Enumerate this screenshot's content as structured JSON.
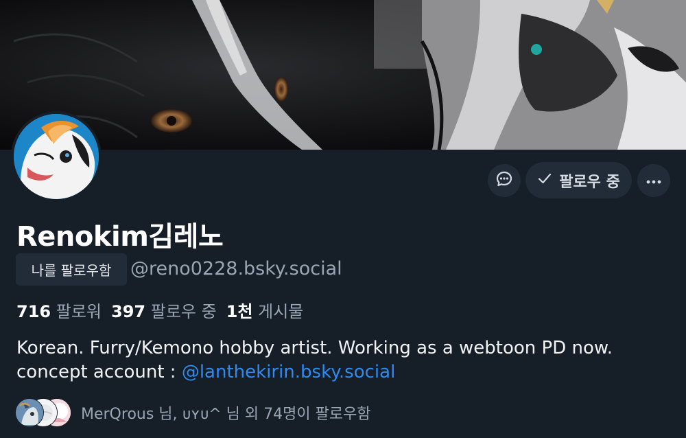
{
  "profile": {
    "display_name": "Renokim김레노",
    "follows_you_label": "나를 팔로우함",
    "handle": "@reno0228.bsky.social"
  },
  "actions": {
    "message_icon": "chat-bubble-icon",
    "follow_label": "팔로우 중",
    "follow_icon": "checkmark-icon",
    "more_icon": "ellipsis-icon"
  },
  "stats": {
    "followers_count": "716",
    "followers_label": "팔로워",
    "following_count": "397",
    "following_label": "팔로우 중",
    "posts_count": "1천",
    "posts_label": "게시물"
  },
  "bio": {
    "line1": "Korean. Furry/Kemono hobby artist. Working as a webtoon PD now.",
    "line2_prefix": "concept account : ",
    "line2_link": "@lanthekirin.bsky.social"
  },
  "known_followers": {
    "text": "MerQrous 님, ᴜʏᴜ^ 님 외 74명이 팔로우함"
  },
  "colors": {
    "background": "#161e27",
    "button_bg": "#222c38",
    "link": "#2f8bf0",
    "muted_text": "#9aa6b3"
  }
}
